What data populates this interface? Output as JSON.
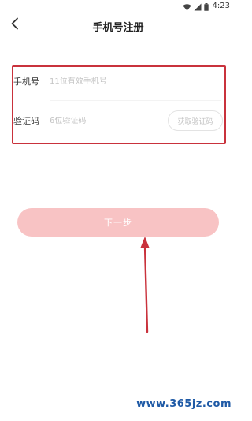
{
  "status_bar": {
    "time": "4:23",
    "icons": [
      "wifi-icon",
      "signal-icon",
      "battery-icon"
    ]
  },
  "header": {
    "back_icon": "chevron-left-icon",
    "title": "手机号注册"
  },
  "form": {
    "phone": {
      "label": "手机号",
      "value": "",
      "placeholder": "11位有效手机号"
    },
    "code": {
      "label": "验证码",
      "value": "",
      "placeholder": "6位验证码",
      "get_code_label": "获取验证码"
    }
  },
  "next_button": {
    "label": "下一步"
  },
  "colors": {
    "annotation_red": "#c9323c",
    "button_disabled_pink": "#f8c3c4",
    "watermark_blue": "#1f5aa6"
  },
  "watermark": "www.365jz.com"
}
